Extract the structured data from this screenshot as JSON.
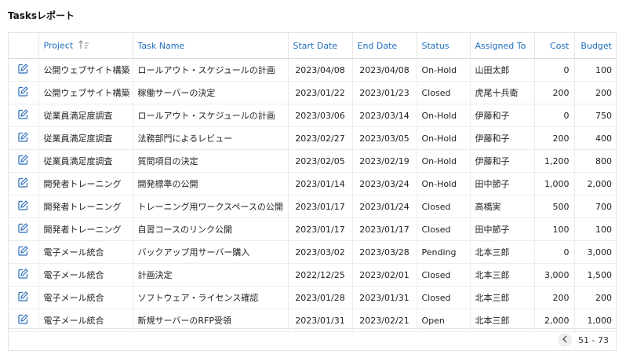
{
  "page": {
    "title": "Tasksレポート"
  },
  "colors": {
    "accent": "#1f6fbf",
    "edit_icon": "#2a6ebb"
  },
  "table": {
    "columns": {
      "project": "Project",
      "task": "Task Name",
      "start": "Start Date",
      "end": "End Date",
      "status": "Status",
      "assigned": "Assigned To",
      "cost": "Cost",
      "budget": "Budget"
    },
    "sort": {
      "column": "project",
      "direction": "ascending",
      "icon": "sort-ascending-icon"
    },
    "rows": [
      {
        "project": "公開ウェブサイト構築",
        "task": "ロールアウト・スケジュールの計画",
        "start": "2023/04/08",
        "end": "2023/04/08",
        "status": "On-Hold",
        "assigned": "山田太郎",
        "cost": "0",
        "budget": "100"
      },
      {
        "project": "公開ウェブサイト構築",
        "task": "稼働サーバーの決定",
        "start": "2023/01/22",
        "end": "2023/01/23",
        "status": "Closed",
        "assigned": "虎尾十兵衛",
        "cost": "200",
        "budget": "200"
      },
      {
        "project": "従業員満足度調査",
        "task": "ロールアウト・スケジュールの計画",
        "start": "2023/03/06",
        "end": "2023/03/14",
        "status": "On-Hold",
        "assigned": "伊藤和子",
        "cost": "0",
        "budget": "750"
      },
      {
        "project": "従業員満足度調査",
        "task": "法務部門によるレビュー",
        "start": "2023/02/27",
        "end": "2023/03/05",
        "status": "On-Hold",
        "assigned": "伊藤和子",
        "cost": "200",
        "budget": "400"
      },
      {
        "project": "従業員満足度調査",
        "task": "質問項目の決定",
        "start": "2023/02/05",
        "end": "2023/02/19",
        "status": "On-Hold",
        "assigned": "伊藤和子",
        "cost": "1,200",
        "budget": "800"
      },
      {
        "project": "開発者トレーニング",
        "task": "開発標準の公開",
        "start": "2023/01/14",
        "end": "2023/03/24",
        "status": "On-Hold",
        "assigned": "田中節子",
        "cost": "1,000",
        "budget": "2,000"
      },
      {
        "project": "開発者トレーニング",
        "task": "トレーニング用ワークスペースの公開",
        "start": "2023/01/17",
        "end": "2023/01/24",
        "status": "Closed",
        "assigned": "高橋実",
        "cost": "500",
        "budget": "700"
      },
      {
        "project": "開発者トレーニング",
        "task": "自習コースのリンク公開",
        "start": "2023/01/17",
        "end": "2023/01/17",
        "status": "Closed",
        "assigned": "田中節子",
        "cost": "100",
        "budget": "100"
      },
      {
        "project": "電子メール統合",
        "task": "バックアップ用サーバー購入",
        "start": "2023/03/02",
        "end": "2023/03/28",
        "status": "Pending",
        "assigned": "北本三郎",
        "cost": "0",
        "budget": "3,000"
      },
      {
        "project": "電子メール統合",
        "task": "計画決定",
        "start": "2022/12/25",
        "end": "2023/02/01",
        "status": "Closed",
        "assigned": "北本三郎",
        "cost": "3,000",
        "budget": "1,500"
      },
      {
        "project": "電子メール統合",
        "task": "ソフトウェア・ライセンス確認",
        "start": "2023/01/28",
        "end": "2023/01/31",
        "status": "Closed",
        "assigned": "北本三郎",
        "cost": "200",
        "budget": "200"
      },
      {
        "project": "電子メール統合",
        "task": "新規サーバーのRFP受領",
        "start": "2023/01/31",
        "end": "2023/02/21",
        "status": "Open",
        "assigned": "北本三郎",
        "cost": "2,000",
        "budget": "1,000"
      }
    ]
  },
  "pagination": {
    "range": "51 - 73",
    "prev_icon": "chevron-left-icon"
  }
}
